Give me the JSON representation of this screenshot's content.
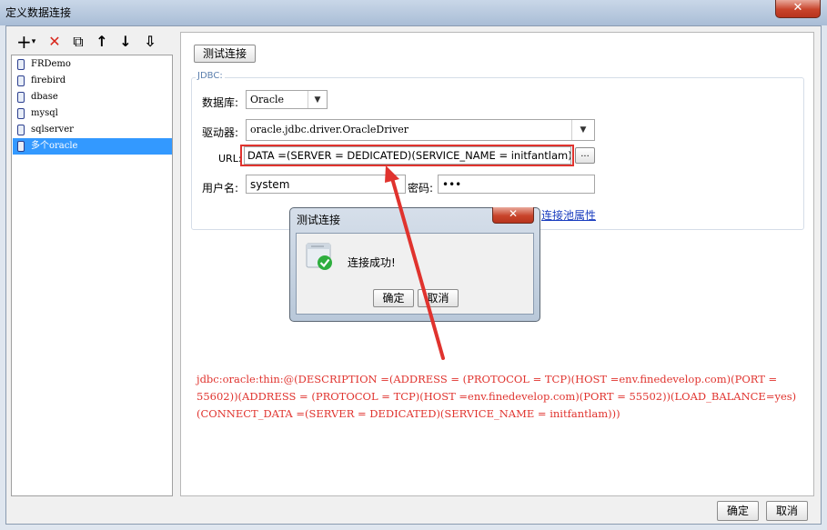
{
  "window": {
    "title": "定义数据连接",
    "close_glyph": "✕"
  },
  "toolbar": {
    "add": "+",
    "add_arrow": "▾",
    "delete": "✕",
    "copy": "⧉",
    "up": "↑",
    "down": "↓",
    "sort": "⇩"
  },
  "tree": {
    "items": [
      {
        "label": "FRDemo",
        "selected": false
      },
      {
        "label": "firebird",
        "selected": false
      },
      {
        "label": "dbase",
        "selected": false
      },
      {
        "label": "mysql",
        "selected": false
      },
      {
        "label": "sqlserver",
        "selected": false
      },
      {
        "label": "多个oracle",
        "selected": true
      }
    ]
  },
  "form": {
    "test_button": "测试连接",
    "legend": "JDBC:",
    "db_label": "数据库:",
    "db_value": "Oracle",
    "driver_label": "驱动器:",
    "driver_value": "oracle.jdbc.driver.OracleDriver",
    "url_label": "URL:",
    "url_value": "DATA =(SERVER = DEDICATED)(SERVICE_NAME = initfantlam)))",
    "url_button": "...",
    "user_label": "用户名:",
    "user_value": "system",
    "password_label": "密码:",
    "password_value": "•••",
    "pool_link": "连接池属性"
  },
  "dialog": {
    "title": "测试连接",
    "close_glyph": "✕",
    "message": "连接成功!",
    "ok": "确定",
    "cancel": "取消"
  },
  "annotation": {
    "line1": "jdbc:oracle:thin:@(DESCRIPTION =(ADDRESS = (PROTOCOL = TCP)(HOST =env.finedevelop.com)(PORT =",
    "line2": "55602))(ADDRESS = (PROTOCOL = TCP)(HOST =env.finedevelop.com)(PORT = 55502))(LOAD_BALANCE=yes)",
    "line3": "(CONNECT_DATA =(SERVER = DEDICATED)(SERVICE_NAME = initfantlam)))"
  },
  "footer": {
    "ok": "确定",
    "cancel": "取消"
  },
  "colors": {
    "accent": "#3399ff",
    "highlight_red": "#e0332e",
    "success_green": "#2eae3e"
  }
}
